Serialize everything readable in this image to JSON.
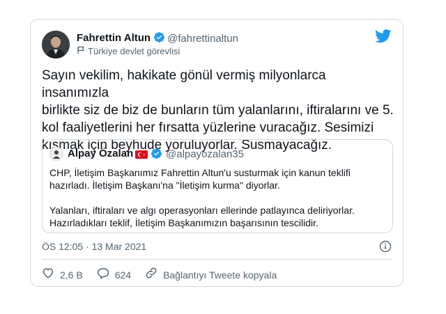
{
  "tweet": {
    "author": {
      "name": "Fahrettin Altun",
      "handle": "@fahrettinaltun",
      "label": "Türkiye devlet görevlisi"
    },
    "text": "Sayın vekilim, hakikate gönül vermiş milyonlarca insanımızla\nbirlikte siz de biz de bunların tüm yalanlarını, iftiralarını ve 5.\nkol faaliyetlerini her fırsatta yüzlerine vuracağız. Sesimizi\nkısmak için beyhude yoruluyorlar. Susmayacağız.",
    "quoted": {
      "name": "Alpay Özalan",
      "handle": "@alpayozalan35",
      "text": "CHP, İletişim Başkanımız Fahrettin Altun'u susturmak için kanun teklifi\nhazırladı. İletişim Başkanı'na \"İletişim kurma\" diyorlar.\n\nYalanları, iftiraları ve algı operasyonları ellerinde patlayınca deliriyorlar.\nHazırladıkları teklif, İletişim Başkanımızın başarısının tescilidir."
    },
    "timestamp": "ÖS 12:05 · 13 Mar 2021",
    "likes": "2,6 B",
    "replies": "624",
    "copy_link_label": "Bağlantıyı Tweete kopyala"
  },
  "colors": {
    "twitter_blue": "#1d9bf0",
    "text": "#0f1419",
    "secondary": "#536471",
    "border": "#cfd9de",
    "flag_red": "#e30a17"
  }
}
